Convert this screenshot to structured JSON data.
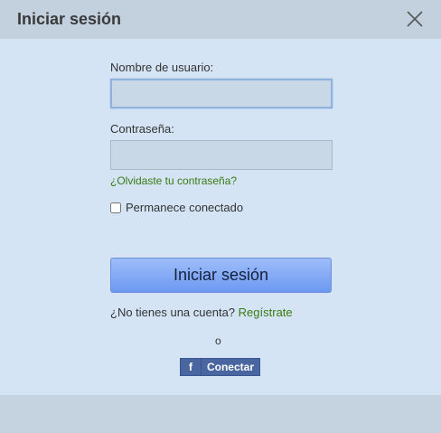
{
  "dialog": {
    "title": "Iniciar sesión",
    "close_icon": "close-icon"
  },
  "form": {
    "username_label": "Nombre de usuario:",
    "username_value": "",
    "password_label": "Contraseña:",
    "password_value": "",
    "forgot_link": "¿Olvidaste tu contraseña?",
    "remember_label": "Permanece conectado",
    "remember_checked": false,
    "submit_label": "Iniciar sesión"
  },
  "signup": {
    "prompt": "¿No tienes una cuenta?",
    "link": "Regístrate"
  },
  "alt": {
    "or_text": "o",
    "facebook_icon": "facebook-icon",
    "facebook_letter": "f",
    "facebook_label": "Conectar"
  },
  "colors": {
    "panel_bg": "#d4e4f5",
    "header_bg": "#c3d1df",
    "link_green": "#3a7a14",
    "button_blue": "#7ca4f4",
    "facebook_blue": "#4a66a0"
  }
}
